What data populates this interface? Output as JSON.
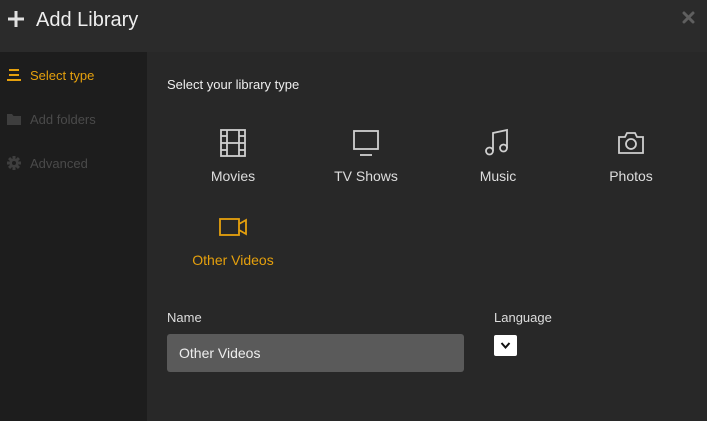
{
  "dialog": {
    "title": "Add Library"
  },
  "sidebar": {
    "items": [
      {
        "label": "Select type",
        "icon": "list-icon",
        "state": "active"
      },
      {
        "label": "Add folders",
        "icon": "folder-icon",
        "state": "disabled"
      },
      {
        "label": "Advanced",
        "icon": "gear-icon",
        "state": "disabled"
      }
    ]
  },
  "main": {
    "heading": "Select your library type",
    "types": [
      {
        "label": "Movies",
        "icon": "film-icon",
        "selected": false
      },
      {
        "label": "TV Shows",
        "icon": "tv-icon",
        "selected": false
      },
      {
        "label": "Music",
        "icon": "music-note-icon",
        "selected": false
      },
      {
        "label": "Photos",
        "icon": "camera-icon",
        "selected": false
      },
      {
        "label": "Other Videos",
        "icon": "video-camera-icon",
        "selected": true
      }
    ],
    "name_label": "Name",
    "name_value": "Other Videos",
    "language_label": "Language",
    "language_value": ""
  },
  "colors": {
    "accent": "#e5a00d",
    "background": "#282828",
    "sidebar": "#1d1d1d",
    "titlebar": "#2b2b2b",
    "input": "#5a5a5a"
  }
}
